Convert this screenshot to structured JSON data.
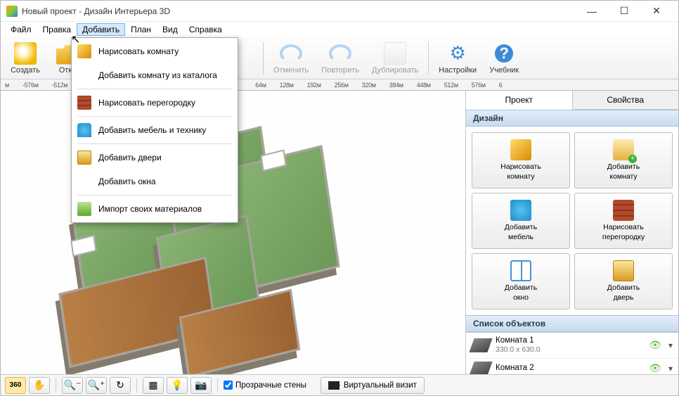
{
  "window": {
    "title": "Новый проект - Дизайн Интерьера 3D"
  },
  "menubar": {
    "file": "Файл",
    "edit": "Правка",
    "add": "Добавить",
    "plan": "План",
    "view": "Вид",
    "help": "Справка"
  },
  "toolbar": {
    "create": "Создать",
    "open": "Откр",
    "undo": "Отменить",
    "redo": "Повторить",
    "duplicate": "Дублировать",
    "settings": "Настройки",
    "tutorial": "Учебник"
  },
  "dropdown": {
    "draw_room": "Нарисовать комнату",
    "add_room_catalog": "Добавить комнату из каталога",
    "draw_partition": "Нарисовать перегородку",
    "add_furniture": "Добавить мебель и технику",
    "add_doors": "Добавить двери",
    "add_windows": "Добавить окна",
    "import_materials": "Импорт своих материалов"
  },
  "ruler": {
    "ticks": [
      "м",
      "-576м",
      "-512м",
      "64м",
      "128м",
      "192м",
      "256м",
      "320м",
      "384м",
      "448м",
      "512м",
      "576м",
      "6"
    ]
  },
  "right": {
    "tabs": {
      "project": "Проект",
      "properties": "Свойства"
    },
    "sections": {
      "design": "Дизайн",
      "objects": "Список объектов"
    },
    "buttons": {
      "draw_room": "Нарисовать\nкомнату",
      "add_room": "Добавить\nкомнату",
      "add_furniture": "Добавить\nмебель",
      "draw_partition": "Нарисовать\nперегородку",
      "add_window": "Добавить\nокно",
      "add_door": "Добавить\nдверь"
    },
    "objects": [
      {
        "name": "Комната 1",
        "dims": "330.0 x 630.0"
      },
      {
        "name": "Комната 2",
        "dims": ""
      }
    ]
  },
  "statusbar": {
    "transparent_walls": "Прозрачные стены",
    "virtual_visit": "Виртуальный визит"
  }
}
